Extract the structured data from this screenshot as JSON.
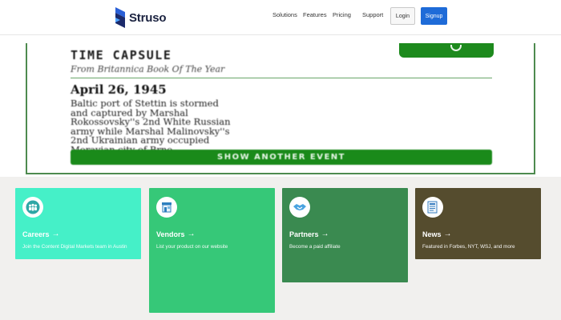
{
  "header": {
    "logo_text": "Struso",
    "nav": [
      "Solutions",
      "Features",
      "Pricing",
      "Support"
    ],
    "login_label": "Login",
    "signup_label": "Signup"
  },
  "time_capsule": {
    "title": "TIME CAPSULE",
    "subtitle": "From Britannica Book Of The Year",
    "date": "April 26, 1945",
    "event_lines": [
      "Baltic port of Stettin is stormed",
      "and captured by Marshal",
      "Rokossovsky''s 2nd White Russian",
      "army while Marshal Malinovsky''s",
      "2nd Ukrainian army occupied",
      "Moravian city of Brno."
    ],
    "button_label": "SHOW ANOTHER EVENT"
  },
  "cards": [
    {
      "title": "Careers",
      "description": "Join the Content Digital Markets team in Austin",
      "color": "#45f0c8",
      "icon": "people-icon"
    },
    {
      "title": "Vendors",
      "description": "List your product on our website",
      "color": "#36c878",
      "icon": "storefront-icon"
    },
    {
      "title": "Partners",
      "description": "Become a paid affiliate",
      "color": "#3a8a50",
      "icon": "handshake-icon"
    },
    {
      "title": "News",
      "description": "Featured in Forbes, NYT, WSJ, and more",
      "color": "#554c2e",
      "icon": "newspaper-icon"
    }
  ],
  "colors": {
    "brand_blue": "#1e6bd8",
    "capsule_green": "#1a8a1a",
    "page_background": "#f1f0ee"
  }
}
